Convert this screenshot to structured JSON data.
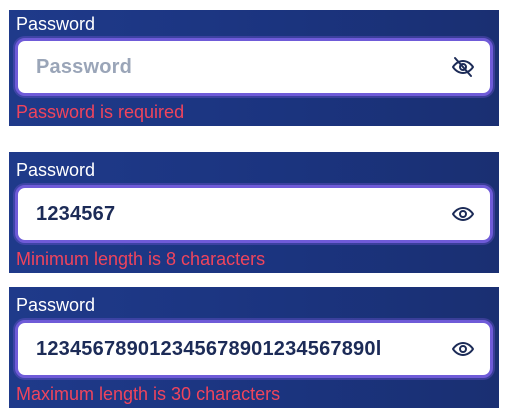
{
  "fields": [
    {
      "label": "Password",
      "value": "",
      "placeholder": "Password",
      "icon": "eye-off-icon",
      "error": "Password is required"
    },
    {
      "label": "Password",
      "value": "1234567",
      "placeholder": "",
      "icon": "eye-icon",
      "error": "Minimum length is 8 characters"
    },
    {
      "label": "Password",
      "value": "123456789012345678901234567890l",
      "placeholder": "",
      "icon": "eye-icon",
      "error": "Maximum length is 30 characters"
    }
  ],
  "colors": {
    "panel_background": "#1f3a8a",
    "field_border": "#6f5bd8",
    "error_text": "#f0445c",
    "value_text": "#1c2b57",
    "placeholder_text": "#9aa5b8",
    "label_text": "#ffffff"
  }
}
